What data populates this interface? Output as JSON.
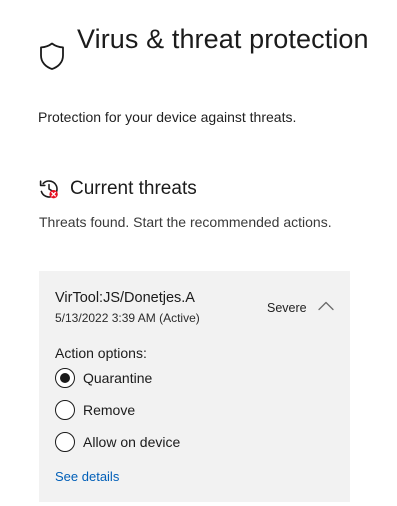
{
  "header": {
    "icon": "shield-icon",
    "title": "Virus & threat protection",
    "subtitle": "Protection for your device against threats."
  },
  "current_threats": {
    "icon": "threat-clock-icon",
    "title": "Current threats",
    "description": "Threats found. Start the recommended actions.",
    "threat": {
      "name": "VirTool:JS/Donetjes.A",
      "date": "5/13/2022 3:39 AM (Active)",
      "severity": "Severe",
      "severity_color": "#c42b1c",
      "action_options_label": "Action options:",
      "options": [
        {
          "label": "Quarantine",
          "selected": true
        },
        {
          "label": "Remove",
          "selected": false
        },
        {
          "label": "Allow on device",
          "selected": false
        }
      ],
      "see_details": "See details"
    }
  },
  "colors": {
    "link": "#005fb8",
    "card_background": "#f2f2f2",
    "alert_badge": "#e81123"
  }
}
